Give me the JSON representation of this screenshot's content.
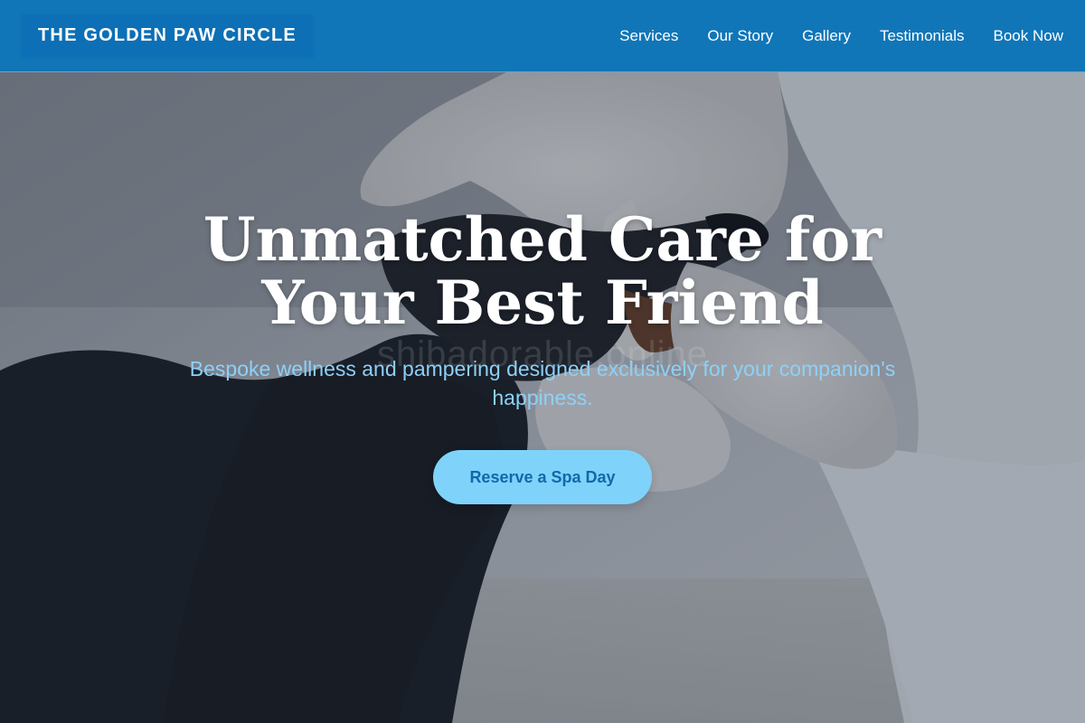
{
  "header": {
    "brand": "THE GOLDEN PAW CIRCLE",
    "nav": [
      {
        "label": "Services"
      },
      {
        "label": "Our Story"
      },
      {
        "label": "Gallery"
      },
      {
        "label": "Testimonials"
      },
      {
        "label": "Book Now"
      }
    ]
  },
  "hero": {
    "title": "Unmatched Care for Your Best Friend",
    "subtitle": "Bespoke wellness and pampering designed exclusively for your companion's happiness.",
    "watermark": "shibadorable.online",
    "cta_label": "Reserve a Spa Day",
    "image_subject": "dachshund-vet-exam-photo"
  },
  "colors": {
    "header_bg": "#1076b8",
    "brand_bg": "#0d6fb5",
    "subtitle": "#8ed0f7",
    "cta_bg": "#7fd3fb",
    "cta_text": "#1169a8"
  }
}
